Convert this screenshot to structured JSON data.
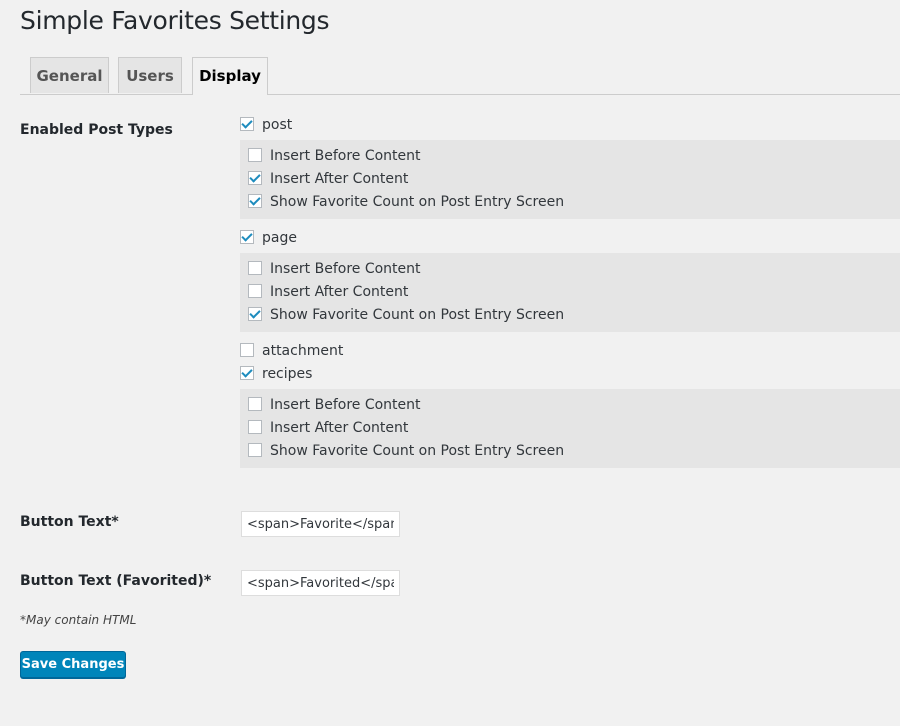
{
  "page_title": "Simple Favorites Settings",
  "tabs": [
    {
      "label": "General",
      "active": false
    },
    {
      "label": "Users",
      "active": false
    },
    {
      "label": "Display",
      "active": true
    }
  ],
  "enabled_post_types": {
    "label": "Enabled Post Types",
    "types": [
      {
        "name": "post",
        "checked": true,
        "options": [
          {
            "label": "Insert Before Content",
            "checked": false
          },
          {
            "label": "Insert After Content",
            "checked": true
          },
          {
            "label": "Show Favorite Count on Post Entry Screen",
            "checked": true
          }
        ]
      },
      {
        "name": "page",
        "checked": true,
        "options": [
          {
            "label": "Insert Before Content",
            "checked": false
          },
          {
            "label": "Insert After Content",
            "checked": false
          },
          {
            "label": "Show Favorite Count on Post Entry Screen",
            "checked": true
          }
        ]
      },
      {
        "name": "attachment",
        "checked": false,
        "options": []
      },
      {
        "name": "recipes",
        "checked": true,
        "options": [
          {
            "label": "Insert Before Content",
            "checked": false
          },
          {
            "label": "Insert After Content",
            "checked": false
          },
          {
            "label": "Show Favorite Count on Post Entry Screen",
            "checked": false
          }
        ]
      }
    ]
  },
  "button_text": {
    "label": "Button Text*",
    "value": "<span>Favorite</span>"
  },
  "button_text_favorited": {
    "label": "Button Text (Favorited)*",
    "value": "<span>Favorited</span>"
  },
  "note": "*May contain HTML",
  "save_label": "Save Changes",
  "colors": {
    "accent": "#0085ba",
    "check": "#1e8cbe",
    "background": "#f1f1f1"
  }
}
